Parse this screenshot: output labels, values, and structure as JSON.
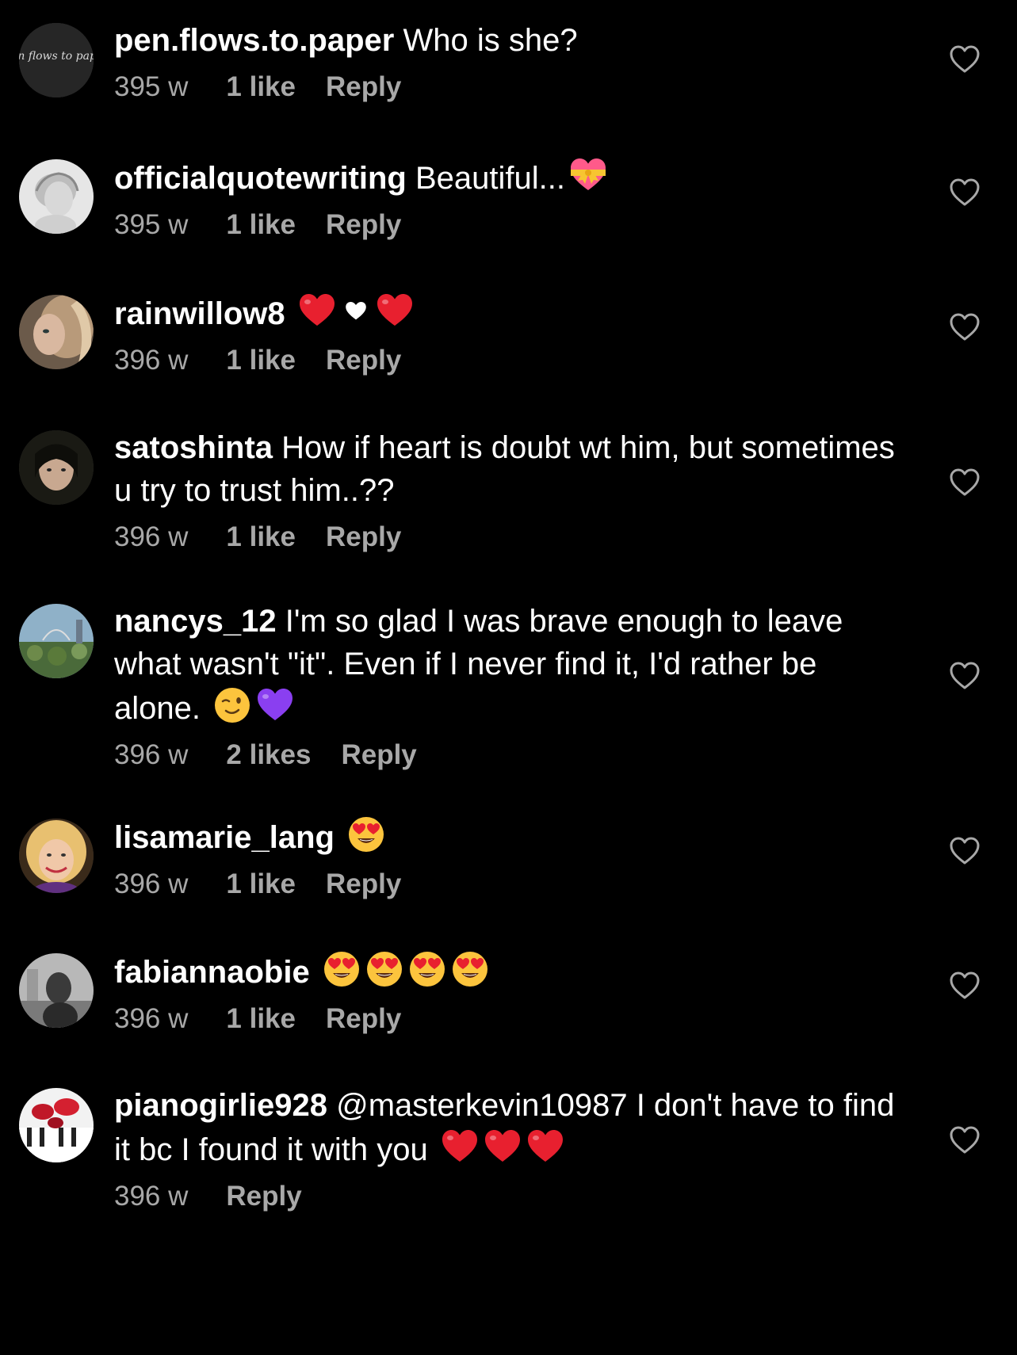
{
  "colors": {
    "background": "#000000",
    "text": "#ffffff",
    "meta": "#a8a8a8",
    "like_icon": "#a8a8a8"
  },
  "comments": [
    {
      "username": "pen.flows.to.paper",
      "text": " Who is she?",
      "emojis": [],
      "time": "395 w",
      "likes": "1 like",
      "reply": "Reply",
      "avatar": "pen-flows-to-paper-logo",
      "avatar_text": "pen flows to paper"
    },
    {
      "username": "officialquotewriting",
      "text": " Beautiful...",
      "emojis": [
        "heart-with-ribbon-emoji"
      ],
      "time": "395 w",
      "likes": "1 like",
      "reply": "Reply",
      "avatar": "sketch-portrait"
    },
    {
      "username": "rainwillow8",
      "text": " ",
      "emojis": [
        "red-heart-emoji",
        "white-heart-emoji",
        "red-heart-emoji"
      ],
      "time": "396 w",
      "likes": "1 like",
      "reply": "Reply",
      "avatar": "woman-portrait"
    },
    {
      "username": "satoshinta",
      "text": " How if heart is doubt wt him, but sometimes u try to trust him..??",
      "emojis": [],
      "time": "396 w",
      "likes": "1 like",
      "reply": "Reply",
      "avatar": "dark-portrait"
    },
    {
      "username": "nancys_12",
      "text": " I'm so glad I was brave enough to leave what wasn't \"it\". Even if I never find it, I'd rather be alone. ",
      "emojis": [
        "winking-face-emoji",
        "purple-heart-emoji"
      ],
      "time": "396 w",
      "likes": "2 likes",
      "reply": "Reply",
      "avatar": "garden-photo"
    },
    {
      "username": "lisamarie_lang",
      "text": " ",
      "emojis": [
        "heart-eyes-emoji"
      ],
      "time": "396 w",
      "likes": "1 like",
      "reply": "Reply",
      "avatar": "blonde-portrait"
    },
    {
      "username": "fabiannaobie",
      "text": " ",
      "emojis": [
        "heart-eyes-emoji",
        "heart-eyes-emoji",
        "heart-eyes-emoji",
        "heart-eyes-emoji"
      ],
      "time": "396 w",
      "likes": "1 like",
      "reply": "Reply",
      "avatar": "grey-portrait"
    },
    {
      "username": "pianogirlie928",
      "mention": "@masterkevin10987",
      "text": " I don't have to find it bc I found it with you ",
      "emojis": [
        "red-heart-emoji",
        "red-heart-emoji",
        "red-heart-emoji"
      ],
      "time": "396 w",
      "likes": "",
      "reply": "Reply",
      "avatar": "piano-roses-photo"
    }
  ]
}
